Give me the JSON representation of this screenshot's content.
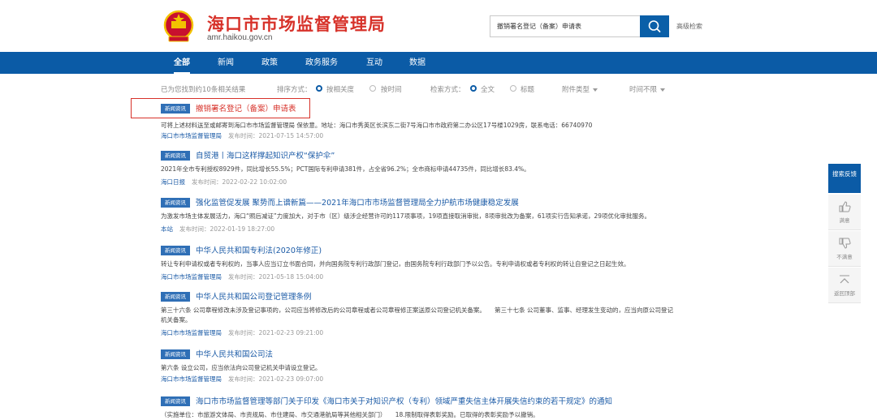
{
  "header": {
    "title": "海口市市场监督管理局",
    "domain": "amr.haikou.gov.cn",
    "search_value": "撤销署名登记（备案）申请表",
    "advanced_search": "高级检索"
  },
  "nav": {
    "items": [
      "全部",
      "新闻",
      "政策",
      "政务服务",
      "互动",
      "数据"
    ]
  },
  "filters": {
    "result_count": "已为您找到约10条相关结果",
    "sort_label": "排序方式：",
    "sort_relevance": "按相关度",
    "sort_time": "按时间",
    "search_mode_label": "检索方式：",
    "mode_fulltext": "全文",
    "mode_title": "标题",
    "attachment_type": "附件类型",
    "time_range": "时间不限"
  },
  "colors": {
    "brand_blue": "#0b5ba6",
    "accent_red": "#d7322a",
    "tag_blue": "#2f6fb6"
  },
  "results": [
    {
      "tag": "新闻资讯",
      "title": "撤销署名登记（备案）申请表",
      "snippet": "可将上述材料送至或邮寄到海口市市场监督管理局 保依意。地址：海口市秀英区长滨东二街7号海口市市政府第二办公区17号楼1029房，联系电话：66740970",
      "source": "海口市市场监督管理局",
      "date": "发布时间：2021-07-15 14:57:00"
    },
    {
      "tag": "新闻资讯",
      "title": "自贸港丨海口这样撑起知识产权“保护伞”",
      "snippet": "2021年全市专利授权8929件，同比增长55.5%；PCT国际专利申请381件，占全省96.2%；全市商标申请44735件，同比增长83.4%。",
      "source": "海口日报",
      "date": "发布时间：2022-02-22 10:02:00"
    },
    {
      "tag": "新闻资讯",
      "title": "强化监管促发展 聚势而上谱新篇——2021年海口市市场监督管理局全力护航市场健康稳定发展",
      "snippet": "为激发市场主体发展活力，海口“照后减证”力度加大，对于市（区）级涉企经营许可的117项事项，19项直接取消审批，8项审批改为备案，61项实行告知承诺，29项优化审批服务。",
      "source": "本站",
      "date": "发布时间：2022-01-19 18:27:00"
    },
    {
      "tag": "新闻资讯",
      "title": "中华人民共和国专利法(2020年修正)",
      "snippet": "转让专利申请权或者专利权的，当事人应当订立书面合同，并向国务院专利行政部门登记，由国务院专利行政部门予以公告。专利申请权或者专利权的转让自登记之日起生效。",
      "source": "海口市市场监督管理局",
      "date": "发布时间：2021-05-18 15:04:00"
    },
    {
      "tag": "新闻资讯",
      "title": "中华人民共和国公司登记管理条例",
      "snippet": "第三十六条 公司章程修改未涉及登记事项的，公司应当将修改后的公司章程或者公司章程修正案送原公司登记机关备案。　　第三十七条 公司董事、监事、经理发生变动的，应当向原公司登记",
      "snippet2": "机关备案。",
      "source": "海口市市场监督管理局",
      "date": "发布时间：2021-02-23 09:21:00"
    },
    {
      "tag": "新闻资讯",
      "title": "中华人民共和国公司法",
      "snippet": "第六条 设立公司，应当依法向公司登记机关申请设立登记。",
      "source": "海口市市场监督管理局",
      "date": "发布时间：2021-02-23 09:07:00"
    },
    {
      "tag": "新闻资讯",
      "title": "海口市市场监督管理等部门关于印发《海口市关于对知识产权（专利）领域严重失信主体开展失信约束的若干规定》的通知",
      "snippet": "（实施单位：市旅游文体局、市资规局、市住建局、市交通港航局等其他相关部门）　　18.限制取得表彰奖励。已取得的表彰奖励予以撤销。"
    }
  ],
  "side_panel": {
    "feedback": "搜索反馈",
    "satisfied": "满意",
    "unsatisfied": "不满意",
    "back_to_top": "返回顶部"
  }
}
